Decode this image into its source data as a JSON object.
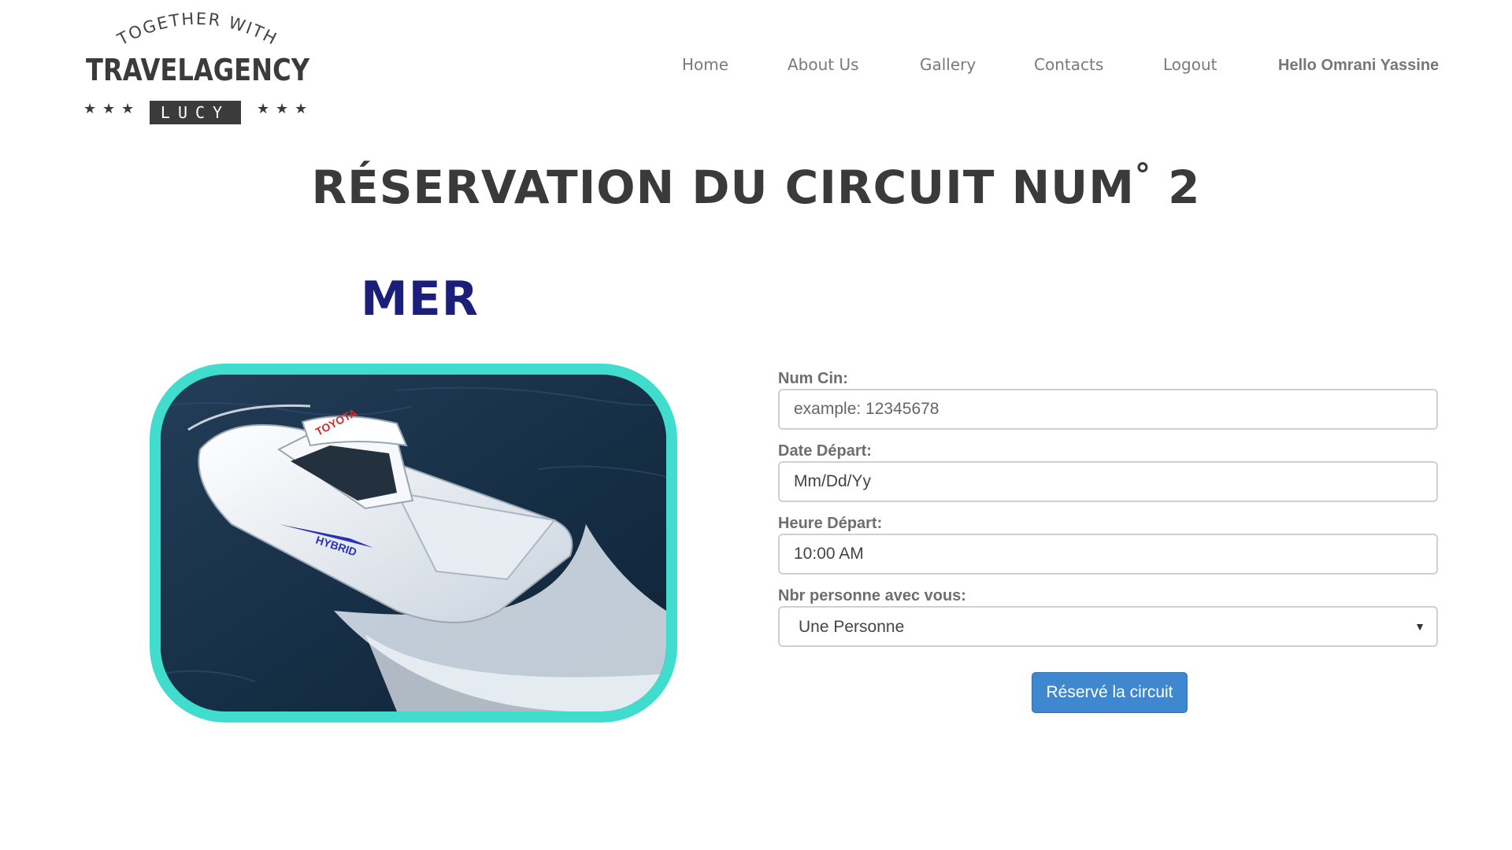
{
  "logo": {
    "top_text": "TOGETHER WITH",
    "main_text": "TRAVELAGENCY",
    "badge_text": "LUCY"
  },
  "nav": {
    "home": "Home",
    "about": "About Us",
    "gallery": "Gallery",
    "contacts": "Contacts",
    "logout": "Logout",
    "greeting": "Hello Omrani Yassine"
  },
  "page": {
    "title": "RÉSERVATION DU CIRCUIT NUM",
    "title_degree": "°",
    "circuit_number": "2",
    "circuit_name": "MER"
  },
  "photo": {
    "boat_brand_text": "TOYOTA",
    "boat_hull_text": "HYBRID"
  },
  "form": {
    "cin_label": "Num Cin:",
    "cin_placeholder": "example: 12345678",
    "date_label": "Date Départ:",
    "date_value": "Mm/Dd/Yy",
    "time_label": "Heure Départ:",
    "time_value": "10:00 AM",
    "people_label": "Nbr personne avec vous:",
    "people_selected": "Une Personne",
    "submit_label": "Réservé la circuit"
  },
  "colors": {
    "accent_button": "#3f88cf",
    "photo_border": "#40dccd",
    "circuit_name": "#1b1f7a"
  }
}
